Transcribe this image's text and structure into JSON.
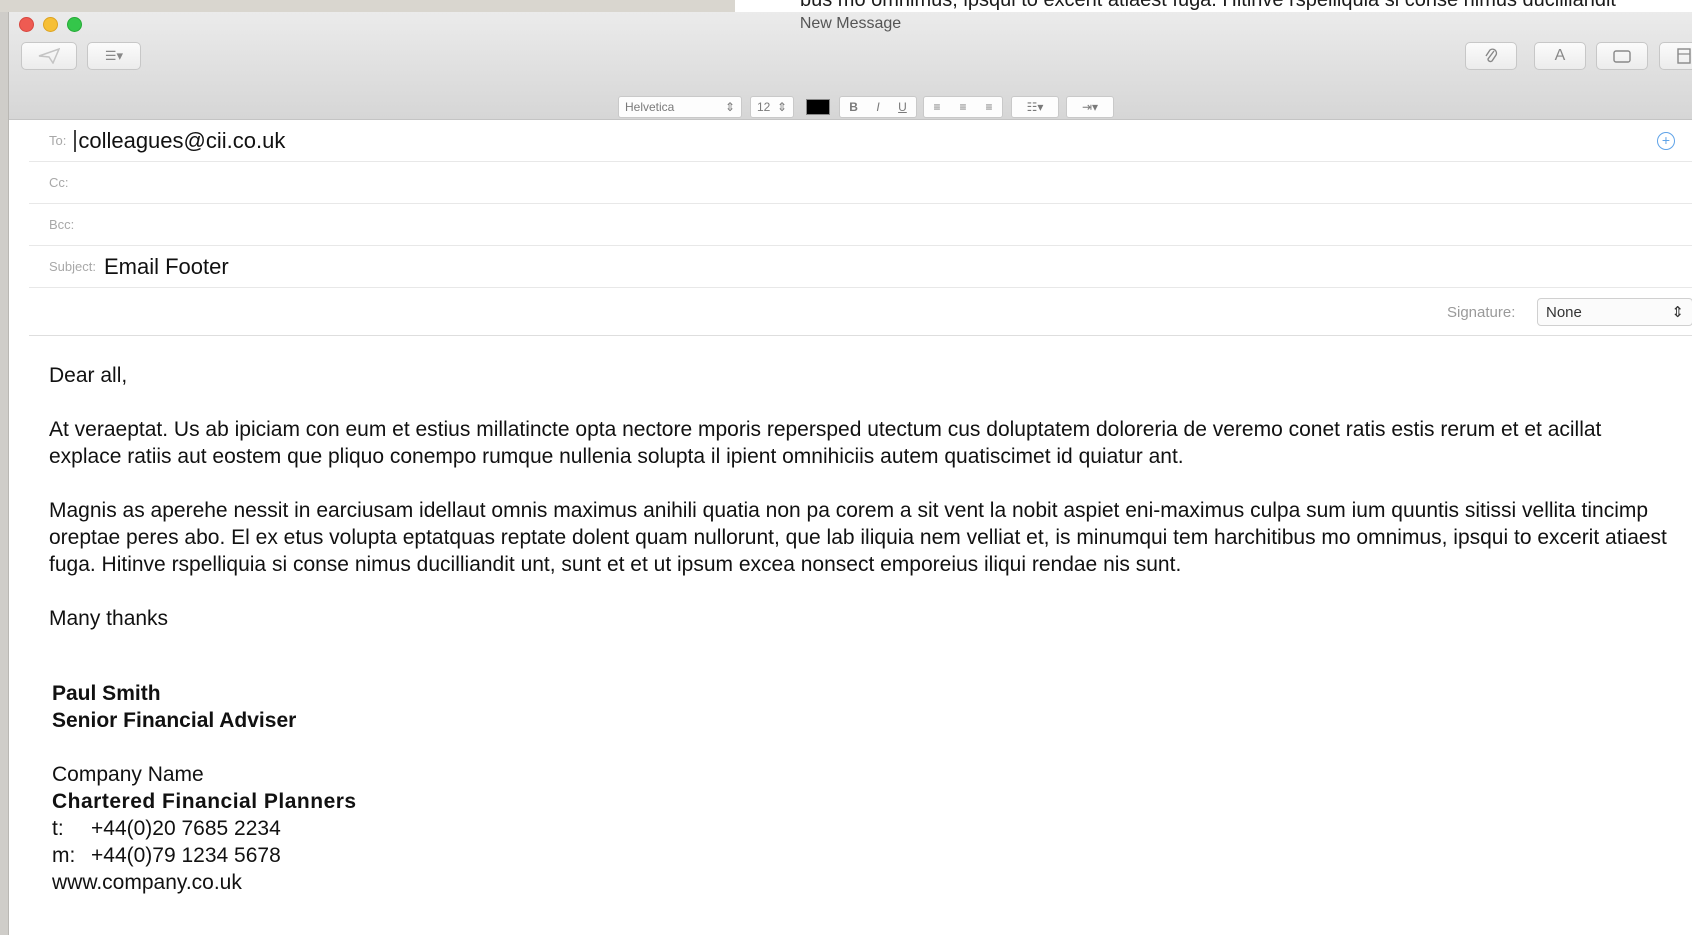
{
  "background": {
    "text": "bus mo omnimus, ipsqui to excerit atiaest fuga. Hitinve rspelliquia si conse nimus ducilliandit"
  },
  "window": {
    "title": "New Message"
  },
  "toolbar": {
    "send_icon": "paper-plane-icon",
    "header_icon": "list-icon",
    "attach_icon": "paperclip-icon",
    "font_icon": "font-icon",
    "photo_icon": "photo-icon",
    "format_icon": "format-icon"
  },
  "format_bar": {
    "font": "Helvetica",
    "size": "12",
    "text_color": "#000000",
    "bold": "B",
    "italic": "I",
    "underline": "U"
  },
  "header": {
    "to_label": "To:",
    "to_value": "colleagues@cii.co.uk",
    "cc_label": "Cc:",
    "bcc_label": "Bcc:",
    "subject_label": "Subject:",
    "subject_value": "Email Footer",
    "signature_label": "Signature:",
    "signature_value": "None"
  },
  "body": {
    "greeting": "Dear all,",
    "paragraph1": "At veraeptat. Us ab ipiciam con eum et estius millatincte opta nectore mporis repersped utectum cus doluptatem doloreria de veremo conet ratis estis rerum et et acillat explace ratiis aut eostem que pliquo conempo rumque nullenia solupta il ipient omnihiciis autem quatiscimet id quiatur ant.",
    "paragraph2": "Magnis as aperehe nessit in earciusam idellaut omnis maximus anihili quatia non pa corem a sit vent la nobit aspiet eni-maximus culpa sum ium quuntis sitissi vellita tincimp oreptae peres abo. El ex etus volupta eptatquas reptate dolent quam nullorunt, que lab iliquia nem velliat et, is minumqui tem harchitibus mo omnimus, ipsqui to excerit atiaest fuga. Hitinve rspelliquia si conse nimus ducilliandit unt, sunt et et ut ipsum excea nonsect emporeius iliqui rendae nis sunt.",
    "closing": "Many thanks"
  },
  "signature": {
    "name": "Paul Smith",
    "title": "Senior Financial Adviser",
    "company_name": "Company Name",
    "company_subtitle": "Chartered Financial Planners",
    "tel_label": "t:",
    "tel_value": "+44(0)20 7685 2234",
    "mobile_label": "m:",
    "mobile_value": "+44(0)79 1234 5678",
    "website": "www.company.co.uk"
  },
  "colors": {
    "close": "#ee5b52",
    "minimize": "#f6bf36",
    "maximize": "#34c64a",
    "accent": "#5fa3e8"
  }
}
